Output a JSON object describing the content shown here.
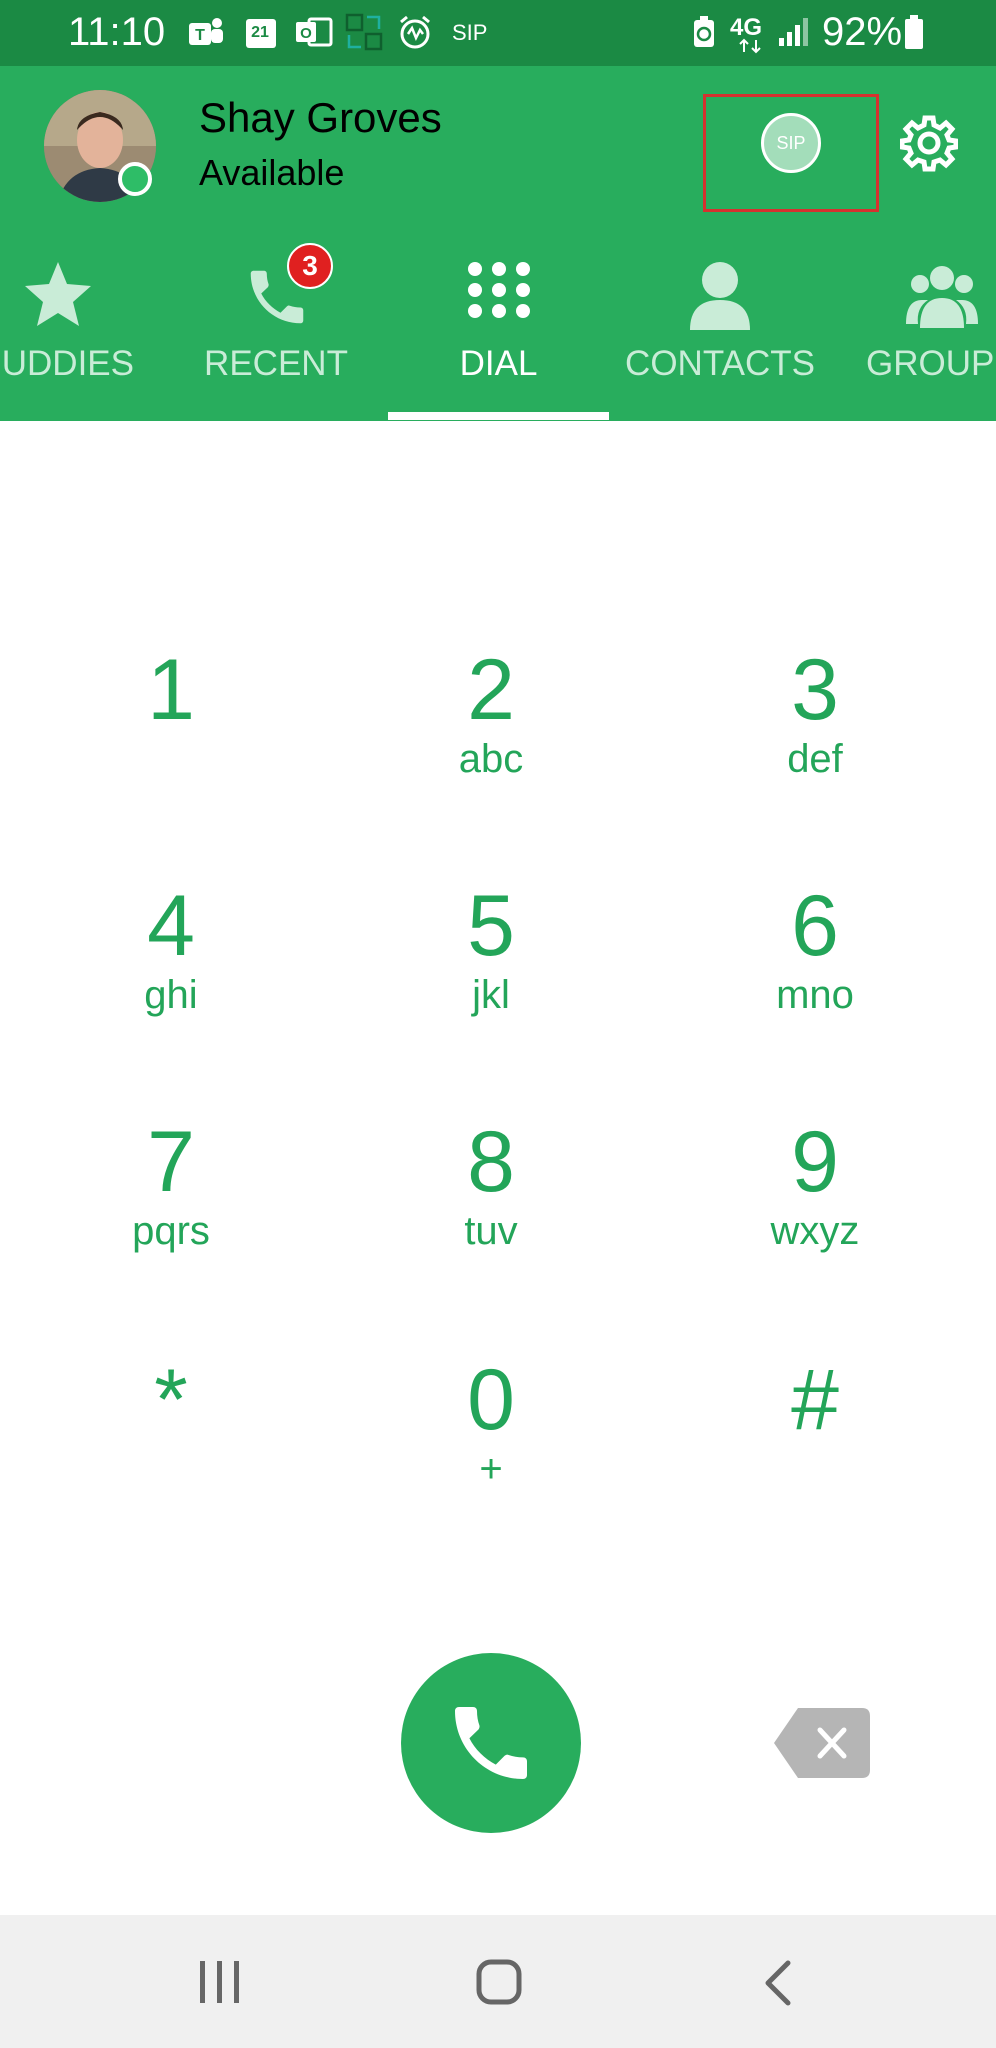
{
  "status_bar": {
    "time": "11:10",
    "calendar_date": "21",
    "sip_label": "SIP",
    "network": "4G",
    "battery": "92%"
  },
  "profile": {
    "name": "Shay Groves",
    "status": "Available",
    "presence_color": "#2ebd67"
  },
  "sip_indicator": {
    "label": "SIP"
  },
  "tabs": [
    {
      "label": "UDDIES",
      "icon": "star-icon"
    },
    {
      "label": "RECENT",
      "icon": "phone-icon",
      "badge": "3"
    },
    {
      "label": "DIAL",
      "icon": "dialpad-icon",
      "active": true
    },
    {
      "label": "CONTACTS",
      "icon": "person-icon"
    },
    {
      "label": "GROUPS",
      "icon": "group-icon"
    }
  ],
  "keypad": [
    {
      "digit": "1",
      "letters": ""
    },
    {
      "digit": "2",
      "letters": "abc"
    },
    {
      "digit": "3",
      "letters": "def"
    },
    {
      "digit": "4",
      "letters": "ghi"
    },
    {
      "digit": "5",
      "letters": "jkl"
    },
    {
      "digit": "6",
      "letters": "mno"
    },
    {
      "digit": "7",
      "letters": "pqrs"
    },
    {
      "digit": "8",
      "letters": "tuv"
    },
    {
      "digit": "9",
      "letters": "wxyz"
    },
    {
      "digit": "*",
      "letters": ""
    },
    {
      "digit": "0",
      "letters": "+"
    },
    {
      "digit": "#",
      "letters": ""
    }
  ],
  "colors": {
    "header_green": "#28ad5d",
    "status_bar_green": "#1b8a44",
    "key_green": "#23a559",
    "badge_red": "#e02020",
    "highlight_red": "#d6312f"
  }
}
